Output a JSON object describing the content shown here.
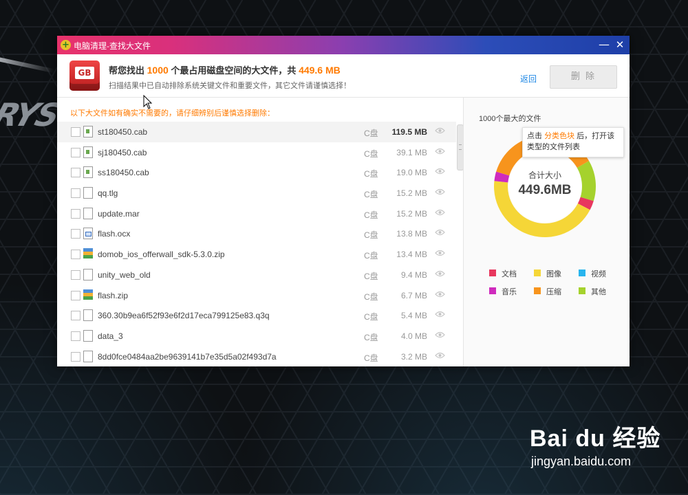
{
  "window": {
    "title": "电脑清理-查找大文件",
    "min_glyph": "—",
    "close_glyph": "✕"
  },
  "header": {
    "icon_text": "GB",
    "headline_prefix": "帮您找出",
    "headline_count": "1000",
    "headline_mid": "个最占用磁盘空间的大文件，共",
    "headline_total": "449.6 MB",
    "subline": "扫描结果中已自动排除系统关键文件和重要文件，其它文件请谨慎选择！",
    "back_label": "返回",
    "delete_label": "删 除"
  },
  "list": {
    "warning": "以下大文件如有确实不需要的，请仔细辨别后谨慎选择删除：",
    "files": [
      {
        "name": "st180450.cab",
        "disk": "C盘",
        "size": "119.5 MB",
        "icon": "cab-file-icon"
      },
      {
        "name": "sj180450.cab",
        "disk": "C盘",
        "size": "39.1 MB",
        "icon": "cab-file-icon"
      },
      {
        "name": "ss180450.cab",
        "disk": "C盘",
        "size": "19.0 MB",
        "icon": "cab-file-icon"
      },
      {
        "name": "qq.tlg",
        "disk": "C盘",
        "size": "15.2 MB",
        "icon": "generic-file-icon"
      },
      {
        "name": "update.mar",
        "disk": "C盘",
        "size": "15.2 MB",
        "icon": "generic-file-icon"
      },
      {
        "name": "flash.ocx",
        "disk": "C盘",
        "size": "13.8 MB",
        "icon": "ocx-file-icon"
      },
      {
        "name": "domob_ios_offerwall_sdk-5.3.0.zip",
        "disk": "C盘",
        "size": "13.4 MB",
        "icon": "zip-file-icon"
      },
      {
        "name": "unity_web_old",
        "disk": "C盘",
        "size": "9.4 MB",
        "icon": "generic-file-icon"
      },
      {
        "name": "flash.zip",
        "disk": "C盘",
        "size": "6.7 MB",
        "icon": "zip-file-icon"
      },
      {
        "name": "360.30b9ea6f52f93e6f2d17eca799125e83.q3q",
        "disk": "C盘",
        "size": "5.4 MB",
        "icon": "generic-file-icon"
      },
      {
        "name": "data_3",
        "disk": "C盘",
        "size": "4.0 MB",
        "icon": "generic-file-icon"
      },
      {
        "name": "8dd0fce0484aa2be9639141b7e35d5a02f493d7a",
        "disk": "C盘",
        "size": "3.2 MB",
        "icon": "generic-file-icon"
      }
    ]
  },
  "summary": {
    "title": "1000个最大的文件",
    "tooltip_prefix": "点击",
    "tooltip_highlight": "分类色块",
    "tooltip_suffix": "后，打开该类型的文件列表",
    "total_label": "合计大小",
    "total_value": "449.6MB",
    "categories": [
      {
        "name": "文档",
        "color": "#e8375e",
        "share": 0.03
      },
      {
        "name": "图像",
        "color": "#f5d637",
        "share": 0.44
      },
      {
        "name": "视频",
        "color": "#29b5ee",
        "share": 0.0
      },
      {
        "name": "音乐",
        "color": "#cf2bbd",
        "share": 0.03
      },
      {
        "name": "压缩",
        "color": "#f7941d",
        "share": 0.37
      },
      {
        "name": "其他",
        "color": "#a5d22d",
        "share": 0.13
      }
    ]
  },
  "watermark": {
    "main": "Bai du 经验",
    "sub": "jingyan.baidu.com"
  }
}
